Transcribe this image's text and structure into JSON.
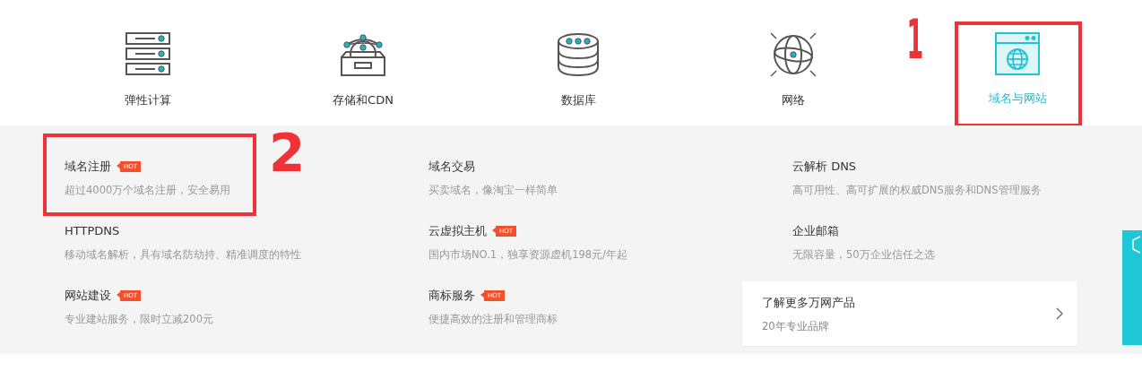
{
  "tabs": [
    {
      "label": "弹性计算",
      "selected": false
    },
    {
      "label": "存储和CDN",
      "selected": false
    },
    {
      "label": "数据库",
      "selected": false
    },
    {
      "label": "网络",
      "selected": false
    },
    {
      "label": "域名与网站",
      "selected": true,
      "annotation": "1"
    }
  ],
  "items": [
    {
      "kind": "product",
      "title": "域名注册",
      "badge": "HOT",
      "desc": "超过4000万个域名注册，安全易用",
      "annotation": "2"
    },
    {
      "kind": "product",
      "title": "域名交易",
      "desc": "买卖域名，像淘宝一样简单"
    },
    {
      "kind": "product",
      "title": "云解析 DNS",
      "desc": "高可用性、高可扩展的权威DNS服务和DNS管理服务"
    },
    {
      "kind": "product",
      "title": "HTTPDNS",
      "desc": "移动域名解析，具有域名防劫持、精准调度的特性"
    },
    {
      "kind": "product",
      "title": "云虚拟主机",
      "badge": "HOT",
      "desc": "国内市场NO.1，独享资源虚机198元/年起"
    },
    {
      "kind": "product",
      "title": "企业邮箱",
      "desc": "无限容量，50万企业信任之选"
    },
    {
      "kind": "product",
      "title": "网站建设",
      "badge": "HOT",
      "desc": "专业建站服务，限时立减200元"
    },
    {
      "kind": "product",
      "title": "商标服务",
      "badge": "HOT",
      "desc": "便捷高效的注册和管理商标"
    },
    {
      "kind": "more",
      "title": "了解更多万网产品",
      "desc": "20年专业品牌"
    }
  ]
}
